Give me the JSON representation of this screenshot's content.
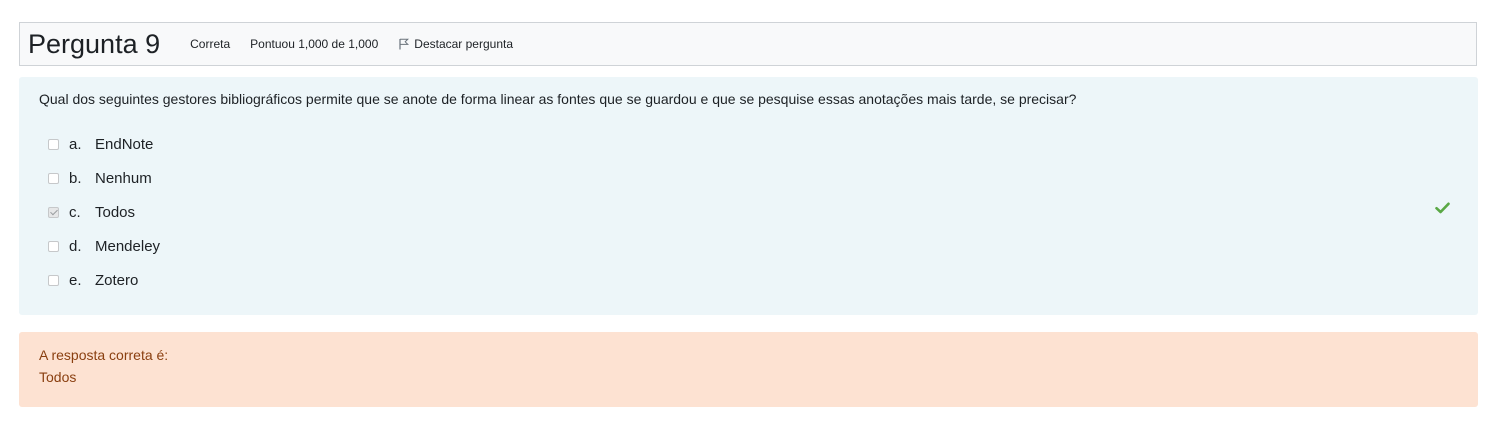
{
  "question": {
    "title_word": "Pergunta",
    "number": "9",
    "state": "Correta",
    "grade": "Pontuou 1,000 de 1,000",
    "flag_label": "Destacar pergunta",
    "text": "Qual dos seguintes gestores bibliográficos permite que se anote de forma linear as fontes que se guardou e que se pesquise essas anotações mais tarde, se precisar?",
    "answers": [
      {
        "letter": "a.",
        "text": "EndNote",
        "checked": false
      },
      {
        "letter": "b.",
        "text": "Nenhum",
        "checked": false
      },
      {
        "letter": "c.",
        "text": "Todos",
        "checked": true
      },
      {
        "letter": "d.",
        "text": "Mendeley",
        "checked": false
      },
      {
        "letter": "e.",
        "text": "Zotero",
        "checked": false
      }
    ]
  },
  "feedback": {
    "label": "A resposta correta é:",
    "answer": "Todos"
  },
  "icons": {
    "flag": "flag-icon",
    "correct": "check-icon"
  },
  "colors": {
    "info_bg": "#f8f9fa",
    "formulation_bg": "#edf6f9",
    "feedback_bg": "#fde2d2",
    "feedback_text": "#8a3f10",
    "correct_green": "#5aa846"
  }
}
